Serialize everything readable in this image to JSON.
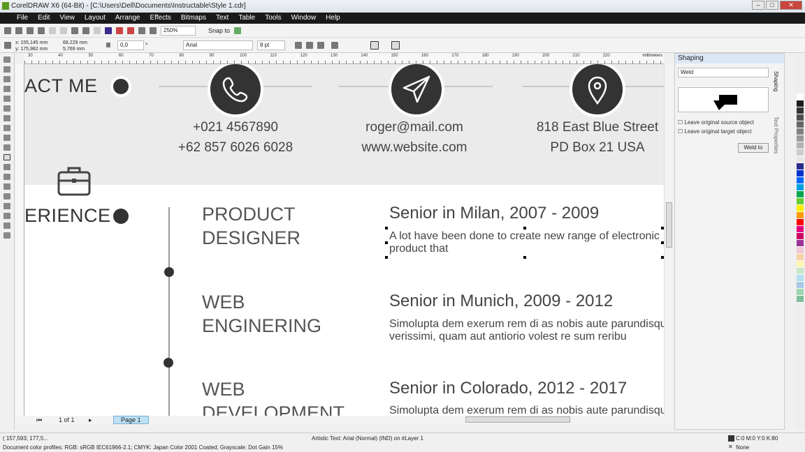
{
  "window": {
    "title": "CorelDRAW X6 (64-Bit) - [C:\\Users\\Dell\\Documents\\Instructable\\Style 1.cdr]"
  },
  "menu": [
    "File",
    "Edit",
    "View",
    "Layout",
    "Arrange",
    "Effects",
    "Bitmaps",
    "Text",
    "Table",
    "Tools",
    "Window",
    "Help"
  ],
  "toolbar": {
    "zoom": "250%",
    "snap_to": "Snap to"
  },
  "propbar": {
    "x": "x: 155,145 mm",
    "y": "y: 175,982 mm",
    "w": "68,229 mm",
    "h": "5,769 mm",
    "angle": "0,0",
    "degree": "°",
    "font": "Arial",
    "size": "8 pt"
  },
  "ruler": {
    "unit": "millimeters",
    "ticks": [
      "30",
      "40",
      "50",
      "60",
      "70",
      "80",
      "90",
      "100",
      "110",
      "120",
      "130",
      "140",
      "150",
      "160",
      "170",
      "180",
      "190",
      "200",
      "210",
      "220"
    ]
  },
  "canvas": {
    "contact_heading": "ACT ME",
    "phones": [
      "+021 4567890",
      "+62 857 6026 6028"
    ],
    "web": [
      "roger@mail.com",
      "www.website.com"
    ],
    "address": [
      "818 East Blue Street",
      "PD Box 21 USA"
    ],
    "experience_heading": "ERIENCE",
    "jobs": [
      {
        "role": [
          "PRODUCT",
          "DESIGNER"
        ],
        "title": "Senior in Milan, 2007 - 2009",
        "desc": [
          "A lot have been done to create new range of electronic",
          "product that"
        ]
      },
      {
        "role": [
          "WEB",
          "ENGINERING"
        ],
        "title": "Senior in Munich, 2009 - 2012",
        "desc": [
          "Simolupta dem exerum rem di as nobis aute parundisqu",
          "verissimi, quam aut antiorio volest re sum reribu"
        ]
      },
      {
        "role": [
          "WEB",
          "DEVELOPMENT"
        ],
        "title": "Senior in Colorado, 2012 - 2017",
        "desc": [
          "Simolupta dem exerum rem di as nobis aute parundisqu"
        ]
      }
    ]
  },
  "pagebar": {
    "count": "1 of 1",
    "tab": "Page 1"
  },
  "docker": {
    "title": "Shaping",
    "mode": "Weld",
    "opt1": "Leave original source object",
    "opt2": "Leave original target object",
    "button": "Weld to",
    "tab1": "Shaping",
    "tab2": "Text Properties"
  },
  "status": {
    "coords": "( 157,593; 177,5... ",
    "object": "Artistic Text: Arial (Normal) (IND) on #Layer 1",
    "profiles": "Document color profiles: RGB: sRGB IEC61966-2.1; CMYK: Japan Color 2001 Coated; Grayscale: Dot Gain 15%",
    "fill": "C:0 M:0 Y:0 K:80",
    "outline": "None"
  },
  "palette": [
    "#ffffff",
    "#1a1a1a",
    "#333333",
    "#4d4d4d",
    "#666666",
    "#808080",
    "#999999",
    "#b3b3b3",
    "#cccccc",
    "#e6e6e6",
    "#2b2b8c",
    "#0033cc",
    "#0066ff",
    "#00a0e0",
    "#00a650",
    "#66cc33",
    "#ffee00",
    "#ff9900",
    "#ff0000",
    "#e6007e",
    "#cc0066",
    "#993399",
    "#f2c7d4",
    "#f5d1a6",
    "#fff5b3",
    "#c8e6c9",
    "#b3dff2",
    "#a8c8e6",
    "#9fd4b0",
    "#7fbf9a"
  ],
  "colors": {
    "accent": "#333333",
    "band": "#ebebeb"
  }
}
